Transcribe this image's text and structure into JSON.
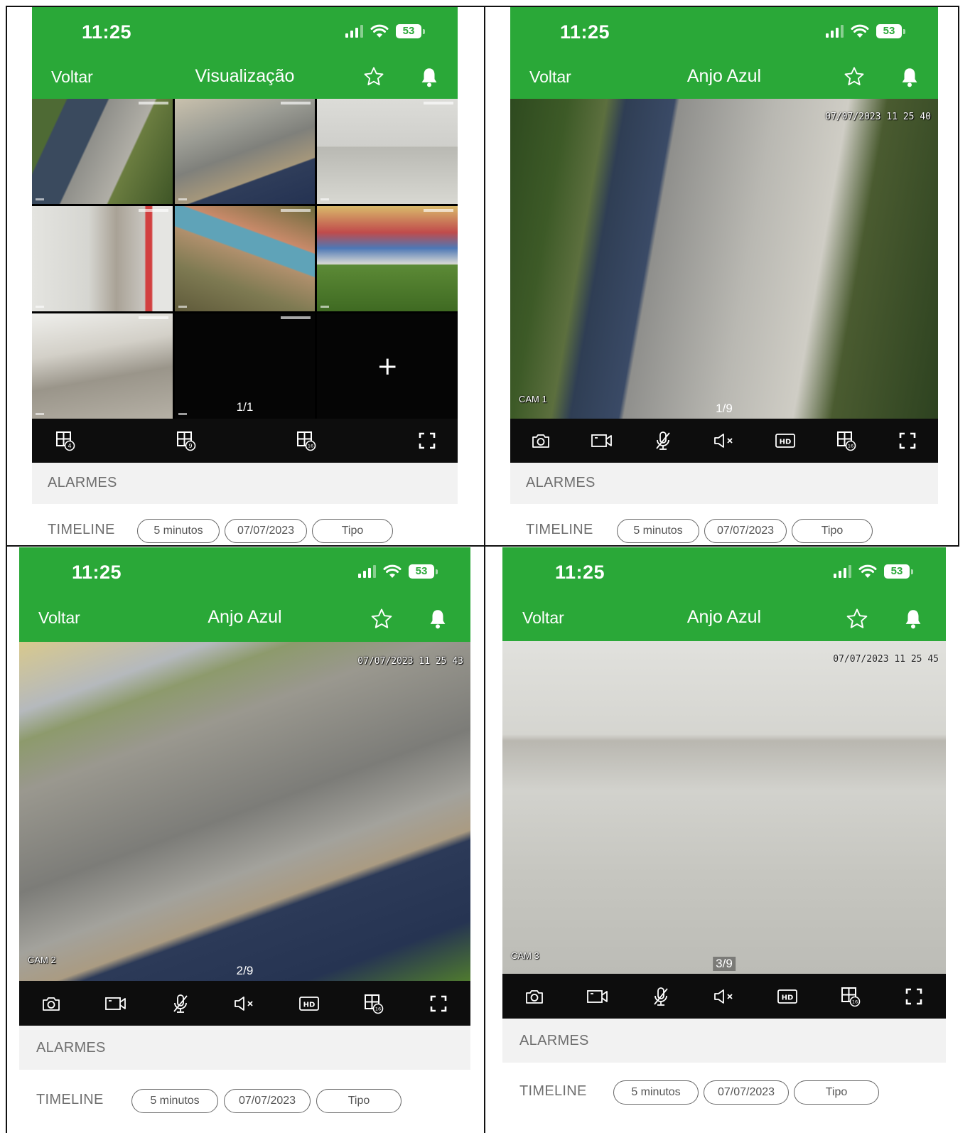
{
  "colors": {
    "brand_green": "#2aa838",
    "control_bar": "#0d0d0d",
    "section_bg": "#f2f2f2",
    "text_muted": "#6f6f6f"
  },
  "panels": [
    {
      "status_time": "11:25",
      "battery": "53",
      "back_label": "Voltar",
      "title": "Visualização",
      "view_mode": "grid",
      "grid_page": "1/1",
      "add_camera_symbol": "+",
      "controls": [
        {
          "icon": "layout-4-icon",
          "badge": "4"
        },
        {
          "icon": "layout-9-icon",
          "badge": "9"
        },
        {
          "icon": "layout-16-icon",
          "badge": "16"
        },
        {
          "icon": "fullscreen-icon"
        }
      ],
      "alarms_label": "ALARMES",
      "timeline_label": "TIMELINE",
      "filter_interval": "5 minutos",
      "filter_date": "07/07/2023",
      "filter_type": "Tipo"
    },
    {
      "status_time": "11:25",
      "battery": "53",
      "back_label": "Voltar",
      "title": "Anjo Azul",
      "view_mode": "single",
      "camera_timestamp": "07/07/2023 11 25 40",
      "camera_name": "CAM 1",
      "camera_page": "1/9",
      "hd_label": "HD",
      "layout_badge": "16",
      "alarms_label": "ALARMES",
      "timeline_label": "TIMELINE",
      "filter_interval": "5 minutos",
      "filter_date": "07/07/2023",
      "filter_type": "Tipo"
    },
    {
      "status_time": "11:25",
      "battery": "53",
      "back_label": "Voltar",
      "title": "Anjo Azul",
      "view_mode": "single",
      "camera_timestamp": "07/07/2023 11 25 43",
      "camera_name": "CAM 2",
      "camera_page": "2/9",
      "hd_label": "HD",
      "layout_badge": "16",
      "alarms_label": "ALARMES",
      "timeline_label": "TIMELINE",
      "filter_interval": "5 minutos",
      "filter_date": "07/07/2023",
      "filter_type": "Tipo"
    },
    {
      "status_time": "11:25",
      "battery": "53",
      "back_label": "Voltar",
      "title": "Anjo Azul",
      "view_mode": "single",
      "camera_timestamp": "07/07/2023 11 25 45",
      "camera_name": "CAM 3",
      "camera_page": "3/9",
      "hd_label": "HD",
      "layout_badge": "16",
      "alarms_label": "ALARMES",
      "timeline_label": "TIMELINE",
      "filter_interval": "5 minutos",
      "filter_date": "07/07/2023",
      "filter_type": "Tipo"
    }
  ]
}
